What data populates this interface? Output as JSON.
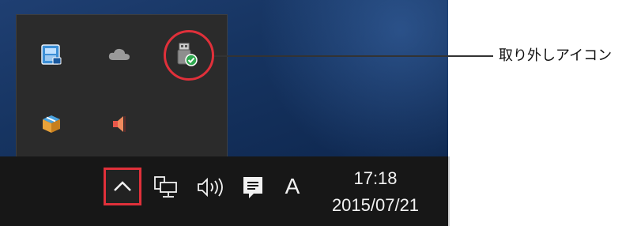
{
  "tray_overflow": {
    "icons": [
      {
        "name": "keyboard-input-icon"
      },
      {
        "name": "onedrive-cloud-icon"
      },
      {
        "name": "safely-remove-hardware-icon"
      },
      {
        "name": "package-box-icon"
      },
      {
        "name": "speaker-muted-icon"
      }
    ]
  },
  "taskbar": {
    "show_hidden_icons": "chevron-up-icon",
    "network": "network-wired-icon",
    "volume": "speaker-volume-icon",
    "action_center": "notification-message-icon",
    "input_language": "A",
    "clock": {
      "time": "17:18",
      "date": "2015/07/21"
    }
  },
  "callout": {
    "label": "取り外しアイコン",
    "accent_color": "#e0303a"
  }
}
